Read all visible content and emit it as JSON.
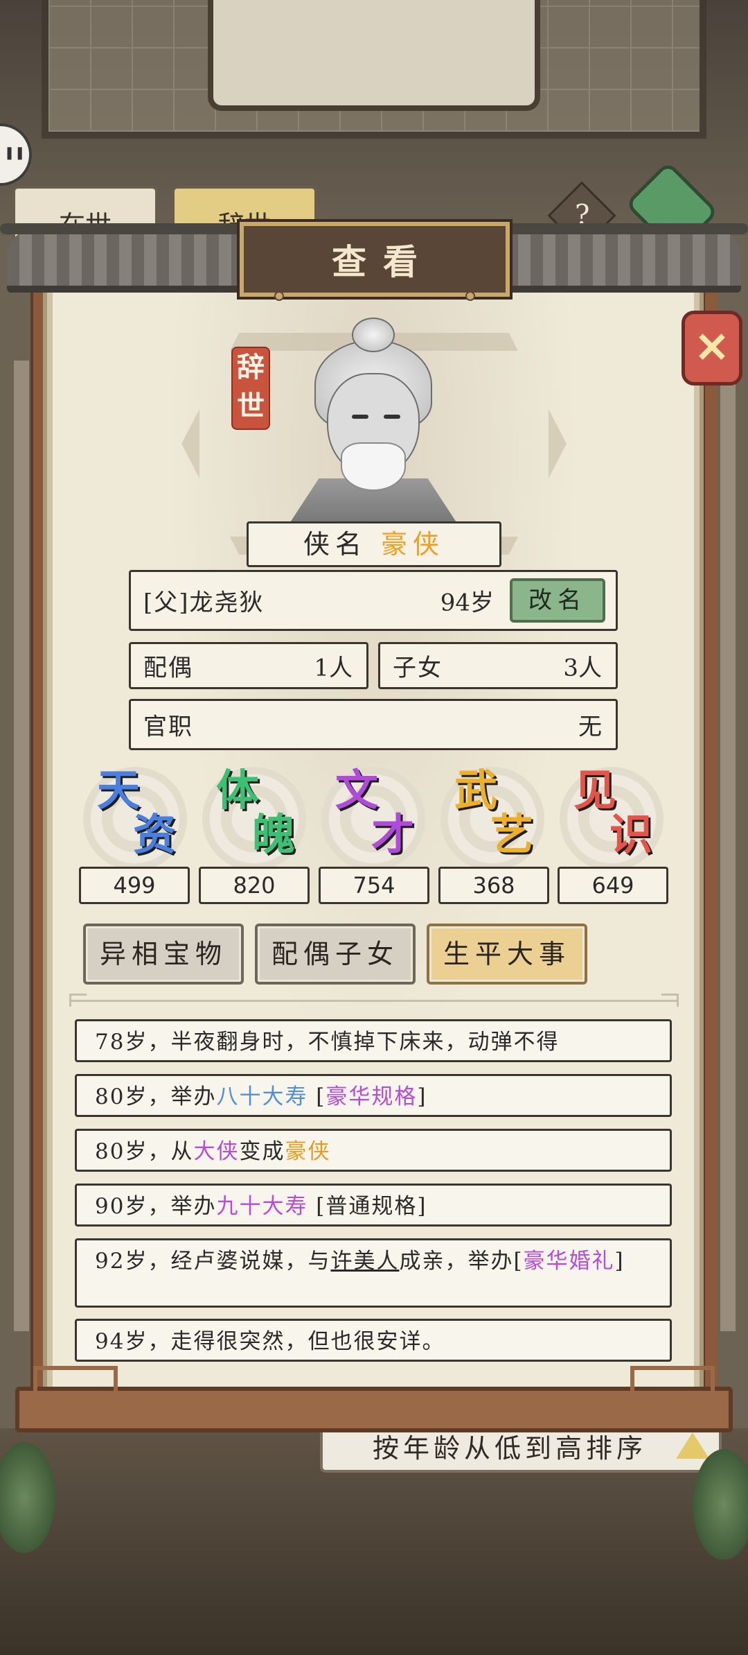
{
  "background": {
    "tab_left": "在世",
    "tab_right": "辞世",
    "help_label": "?",
    "sort_label": "按年龄从低到高排序"
  },
  "dialog": {
    "title": "查看",
    "close_glyph": "✕",
    "status_seal": "辞世"
  },
  "profile": {
    "hero_name_label": "侠名",
    "hero_name_value": "豪侠",
    "relation_name": "[父]龙尧狄",
    "age": "94岁",
    "rename_button": "改名",
    "spouse_label": "配偶",
    "spouse_value": "1人",
    "children_label": "子女",
    "children_value": "3人",
    "office_label": "官职",
    "office_value": "无"
  },
  "attributes": [
    {
      "label_top": "天",
      "label_bottom": "资",
      "value": "499",
      "color": "#4a7fe0"
    },
    {
      "label_top": "体",
      "label_bottom": "魄",
      "value": "820",
      "color": "#3dbf74"
    },
    {
      "label_top": "文",
      "label_bottom": "才",
      "value": "754",
      "color": "#b04ad8"
    },
    {
      "label_top": "武",
      "label_bottom": "艺",
      "value": "368",
      "color": "#ecb02a"
    },
    {
      "label_top": "见",
      "label_bottom": "识",
      "value": "649",
      "color": "#e5544a"
    }
  ],
  "tabs": [
    {
      "label": "异相宝物",
      "active": false
    },
    {
      "label": "配偶子女",
      "active": false
    },
    {
      "label": "生平大事",
      "active": true
    }
  ],
  "events": {
    "e1": {
      "text": "78岁，半夜翻身时，不慎掉下床来，动弹不得"
    },
    "e2": {
      "prefix": "80岁，举办",
      "highlight": "八十大寿",
      "mid": " [",
      "tag": "豪华规格",
      "suffix": "]"
    },
    "e3": {
      "prefix": "80岁，从",
      "from": "大侠",
      "mid": "变成",
      "to": "豪侠"
    },
    "e4": {
      "prefix": "90岁，举办",
      "highlight": "九十大寿",
      "suffix": " [普通规格]"
    },
    "e5": {
      "prefix": "92岁，经卢婆说媒，与",
      "partner": "许美人",
      "mid": "成亲，举办[",
      "tag": "豪华婚礼",
      "suffix": "]"
    },
    "e6": {
      "text": "94岁，走得很突然，但也很安详。"
    }
  }
}
